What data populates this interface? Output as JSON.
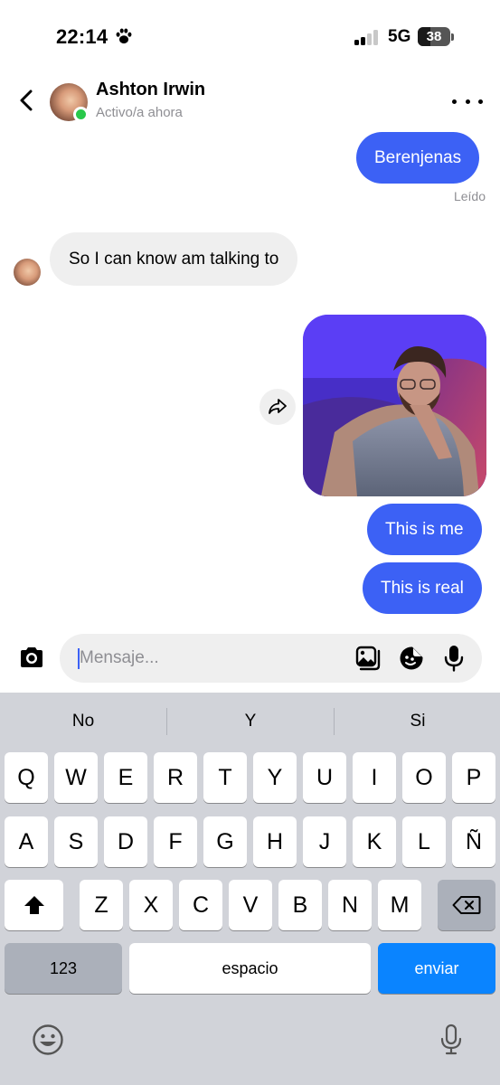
{
  "status_bar": {
    "time": "22:14",
    "network": "5G",
    "battery": "38",
    "battery_level": 0.38
  },
  "header": {
    "contact_name": "Ashton Irwin",
    "contact_status": "Activo/a ahora"
  },
  "messages": [
    {
      "type": "text",
      "direction": "outgoing",
      "text": "Berenjenas"
    },
    {
      "type": "read_receipt",
      "text": "Leído"
    },
    {
      "type": "text",
      "direction": "incoming",
      "text": "So I can know am talking to"
    },
    {
      "type": "photo",
      "direction": "outgoing"
    },
    {
      "type": "text",
      "direction": "outgoing",
      "text": "This is me"
    },
    {
      "type": "text",
      "direction": "outgoing",
      "text": "This is real"
    }
  ],
  "composer": {
    "placeholder": "Mensaje..."
  },
  "keyboard": {
    "suggestions": [
      "No",
      "Y",
      "Si"
    ],
    "row1": [
      "Q",
      "W",
      "E",
      "R",
      "T",
      "Y",
      "U",
      "I",
      "O",
      "P"
    ],
    "row2": [
      "A",
      "S",
      "D",
      "F",
      "G",
      "H",
      "J",
      "K",
      "L",
      "Ñ"
    ],
    "row3": [
      "Z",
      "X",
      "C",
      "V",
      "B",
      "N",
      "M"
    ],
    "numbers_label": "123",
    "space_label": "espacio",
    "send_label": "enviar"
  },
  "colors": {
    "outgoing_bubble": "#3c61f5",
    "incoming_bubble": "#efefef",
    "online_dot": "#29c84a",
    "send_key": "#0a84ff",
    "keyboard_bg": "#d1d3d9"
  },
  "icons": {
    "back": "chevron-left-icon",
    "more": "more-horizontal-icon",
    "share": "share-arrow-icon",
    "camera": "camera-icon",
    "gallery": "gallery-icon",
    "sticker": "sticker-icon",
    "mic": "microphone-icon",
    "shift": "shift-icon",
    "backspace": "backspace-icon",
    "emoji": "emoji-icon",
    "dictation": "dictation-mic-icon"
  }
}
